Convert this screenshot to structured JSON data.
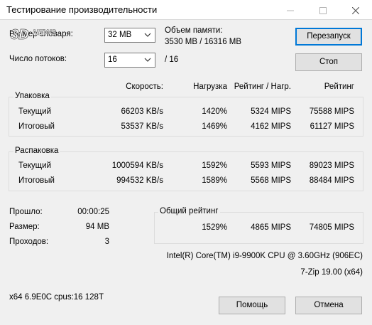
{
  "window": {
    "title": "Тестирование производительности"
  },
  "watermark": "3DNEWS",
  "dict_size": {
    "label": "Размер словаря:",
    "value": "32 MB"
  },
  "threads": {
    "label": "Число потоков:",
    "value": "16",
    "total": "/ 16"
  },
  "memory": {
    "label": "Объем памяти:",
    "value": "3530 MB / 16316 MB"
  },
  "buttons": {
    "restart": "Перезапуск",
    "stop": "Стоп",
    "help": "Помощь",
    "cancel": "Отмена"
  },
  "columns": {
    "speed": "Скорость:",
    "load": "Нагрузка",
    "rating_load": "Рейтинг / Нагр.",
    "rating": "Рейтинг"
  },
  "compression": {
    "title": "Упаковка",
    "rows": [
      {
        "name": "Текущий",
        "speed": "66203 KB/s",
        "load": "1420%",
        "rating_load": "5324 MIPS",
        "rating": "75588 MIPS"
      },
      {
        "name": "Итоговый",
        "speed": "53537 KB/s",
        "load": "1469%",
        "rating_load": "4162 MIPS",
        "rating": "61127 MIPS"
      }
    ]
  },
  "decompression": {
    "title": "Распаковка",
    "rows": [
      {
        "name": "Текущий",
        "speed": "1000594 KB/s",
        "load": "1592%",
        "rating_load": "5593 MIPS",
        "rating": "89023 MIPS"
      },
      {
        "name": "Итоговый",
        "speed": "994532 KB/s",
        "load": "1589%",
        "rating_load": "5568 MIPS",
        "rating": "88484 MIPS"
      }
    ]
  },
  "stats": {
    "elapsed_label": "Прошло:",
    "elapsed": "00:00:25",
    "size_label": "Размер:",
    "size": "94 MB",
    "passes_label": "Проходов:",
    "passes": "3"
  },
  "total": {
    "title": "Общий рейтинг",
    "load": "1529%",
    "rating_load": "4865 MIPS",
    "rating": "74805 MIPS"
  },
  "cpu": "Intel(R) Core(TM) i9-9900K CPU @ 3.60GHz (906EC)",
  "version": "7-Zip 19.00 (x64)",
  "sysinfo": "x64 6.9E0C cpus:16 128T"
}
